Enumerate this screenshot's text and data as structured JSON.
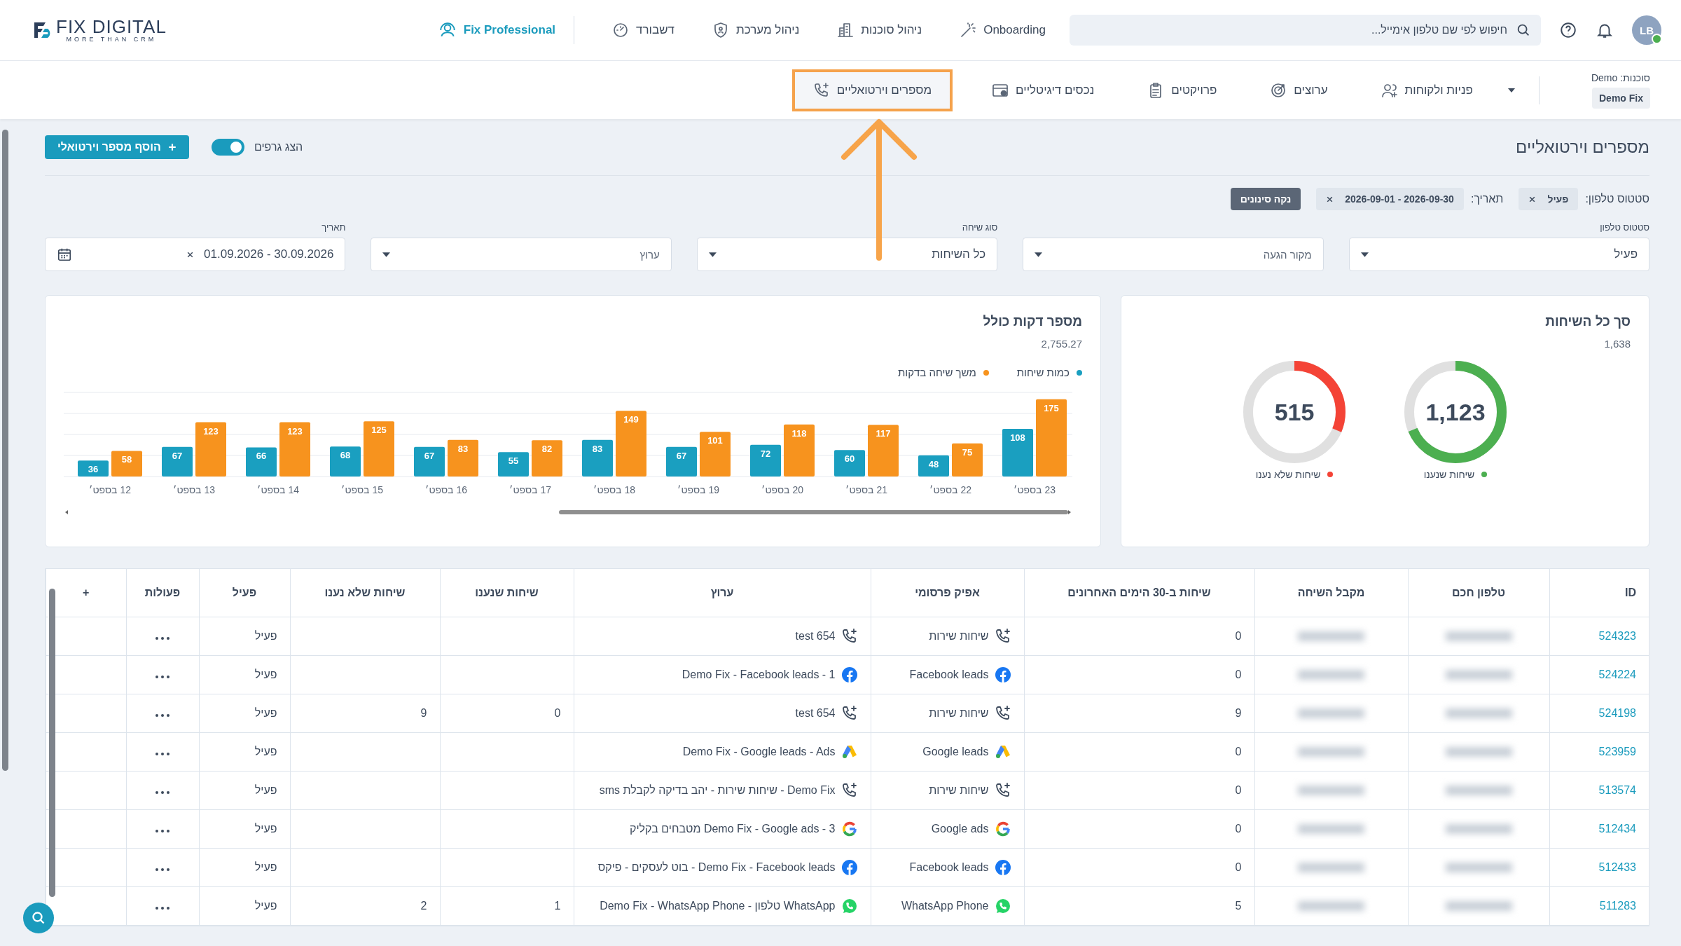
{
  "brand": {
    "name": "FIX DIGITAL",
    "tagline": "MORE THAN CRM"
  },
  "top_nav": {
    "user": {
      "initials": "LB",
      "online": true
    },
    "search": {
      "placeholder": "חיפוש לפי שם טלפון אימייל..."
    },
    "items": [
      {
        "label": "Onboarding",
        "kind": "wand"
      },
      {
        "label": "ניהול סוכנות",
        "kind": "building"
      },
      {
        "label": "ניהול מערכת",
        "kind": "shield"
      },
      {
        "label": "דשבורד",
        "kind": "gauge"
      }
    ],
    "plan": {
      "label": "Fix Professional"
    }
  },
  "agency": {
    "label": "סוכנות: Demo",
    "value": "Demo Fix"
  },
  "tabs": [
    {
      "label": "פניות ולקוחות",
      "kind": "users",
      "selected": false
    },
    {
      "label": "ערוצים",
      "kind": "target",
      "selected": false
    },
    {
      "label": "פרויקטים",
      "kind": "clipboard",
      "selected": false
    },
    {
      "label": "נכסים דיגיטליים",
      "kind": "browser",
      "selected": false
    },
    {
      "label": "מספרים וירטואליים",
      "kind": "phone",
      "selected": true
    }
  ],
  "page": {
    "title": "מספרים וירטואליים",
    "show_charts": {
      "label": "הצג גרפים",
      "on": true
    },
    "add_button": {
      "label": "הוסף מספר וירטואלי"
    }
  },
  "active_filters": [
    {
      "label": "סטטוס טלפון:",
      "value": "פעיל"
    },
    {
      "label": "תאריך:",
      "value": "2026-09-01 - 2026-09-30"
    }
  ],
  "clear_filters": "נקה סינונים",
  "filters": [
    {
      "kind": "select",
      "label": "סטטוס טלפון",
      "value": "פעיל"
    },
    {
      "kind": "select",
      "placeholder": "מקור הגעה"
    },
    {
      "kind": "select",
      "label": "סוג שיחה",
      "value": "כל השיחות"
    },
    {
      "kind": "select",
      "placeholder": "ערוץ"
    },
    {
      "kind": "date",
      "label": "תאריך",
      "value": "01.09.2026 - 30.09.2026"
    }
  ],
  "minutes_card": {
    "title": "מספר דקות כולל",
    "total": "2,755.27",
    "chart_data": {
      "type": "bar",
      "categories": [
        "12 בספט׳",
        "13 בספט׳",
        "14 בספט׳",
        "15 בספט׳",
        "16 בספט׳",
        "17 בספט׳",
        "18 בספט׳",
        "19 בספט׳",
        "20 בספט׳",
        "21 בספט׳",
        "22 בספט׳",
        "23 בספט׳"
      ],
      "data_labels": true,
      "series": [
        {
          "name": "כמות שיחות",
          "color": "#1a9fc0",
          "values": [
            36,
            67,
            66,
            68,
            67,
            55,
            83,
            67,
            72,
            60,
            48,
            108
          ]
        },
        {
          "name": "משך שיחה בדקות",
          "color": "#f7931e",
          "values": [
            58,
            123,
            123,
            125,
            83,
            82,
            149,
            101,
            118,
            117,
            75,
            175
          ]
        }
      ]
    }
  },
  "calls_card": {
    "title": "סך כל השיחות",
    "total": "1,638",
    "meters": [
      {
        "label": "שיחות שנענו",
        "value": "1,123",
        "level": 0.686,
        "color": "#4caf50"
      },
      {
        "label": "שיחות שלא נענו",
        "value": "515",
        "level": 0.314,
        "color": "#f44336"
      }
    ]
  },
  "table": {
    "columns": [
      "ID",
      "טלפון חכם",
      "מקבל השיחה",
      "שיחות ב-30 הימים האחרונים",
      "אפיק פרסומי",
      "ערוץ",
      "שיחות שנענו",
      "שיחות שלא נענו",
      "פעיל",
      "פעולות",
      "+"
    ],
    "rows": [
      {
        "id": "524323",
        "calls_30d": "0",
        "source": {
          "kind": "phone",
          "label": "שיחות שירות"
        },
        "channel": {
          "kind": "phone",
          "label": "test 654"
        },
        "status": "פעיל"
      },
      {
        "id": "524224",
        "calls_30d": "0",
        "source": {
          "kind": "facebook",
          "label": "Facebook leads"
        },
        "channel": {
          "kind": "facebook",
          "label": "Demo Fix - Facebook leads - 1"
        },
        "status": "פעיל"
      },
      {
        "id": "524198",
        "calls_30d": "9",
        "source": {
          "kind": "phone",
          "label": "שיחות שירות"
        },
        "channel": {
          "kind": "phone",
          "label": "test 654"
        },
        "answered": "0",
        "unanswered": "9",
        "status": "פעיל"
      },
      {
        "id": "523959",
        "calls_30d": "0",
        "source": {
          "kind": "google_ads",
          "label": "Google leads"
        },
        "channel": {
          "kind": "google_ads",
          "label": "Demo Fix - Google leads - Ads"
        },
        "status": "פעיל"
      },
      {
        "id": "513574",
        "calls_30d": "0",
        "source": {
          "kind": "phone",
          "label": "שיחות שירות"
        },
        "channel": {
          "kind": "phone",
          "label": "Demo Fix - שיחות שירות - יהב בדיקה לקבלת sms"
        },
        "status": "פעיל"
      },
      {
        "id": "512434",
        "calls_30d": "0",
        "source": {
          "kind": "google",
          "label": "Google ads"
        },
        "channel": {
          "kind": "google",
          "label": "Demo Fix - Google ads - 3 מטבחים בקליק"
        },
        "status": "פעיל"
      },
      {
        "id": "512433",
        "calls_30d": "0",
        "source": {
          "kind": "facebook",
          "label": "Facebook leads"
        },
        "channel": {
          "kind": "facebook",
          "label": "Demo Fix - Facebook leads - בוט לעסקים - פיקס"
        },
        "status": "פעיל"
      },
      {
        "id": "511283",
        "calls_30d": "5",
        "source": {
          "kind": "whatsapp",
          "label": "WhatsApp Phone"
        },
        "channel": {
          "kind": "whatsapp",
          "label": "WhatsApp טלפון - Demo Fix - WhatsApp Phone"
        },
        "answered": "1",
        "unanswered": "2",
        "status": "פעיל"
      }
    ]
  }
}
